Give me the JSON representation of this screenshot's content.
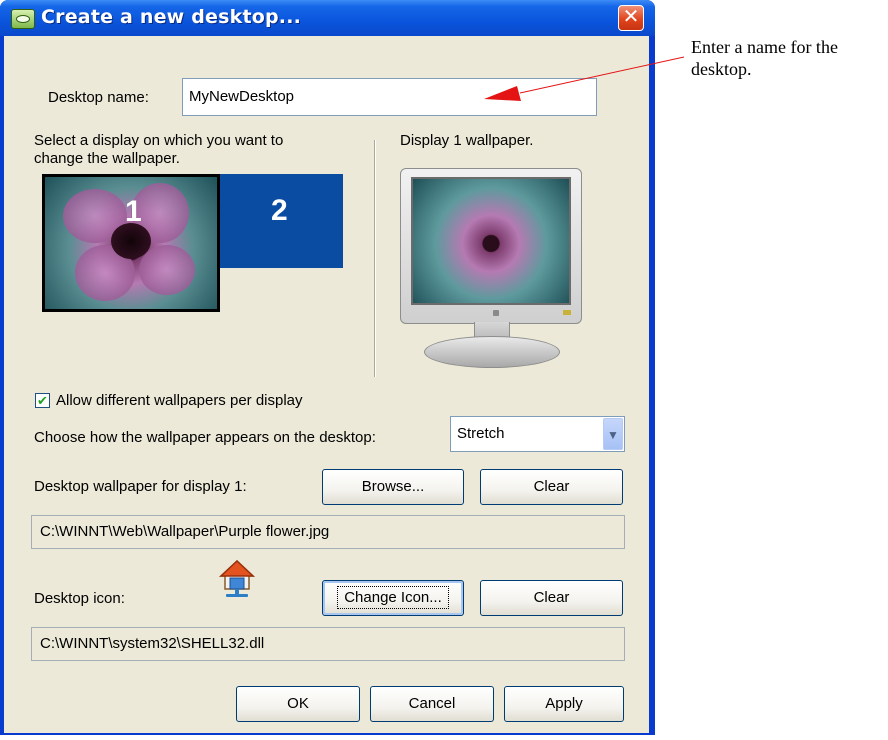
{
  "window": {
    "title": "Create a new desktop..."
  },
  "desktop_name": {
    "label": "Desktop name:",
    "value": "MyNewDesktop"
  },
  "display_selector": {
    "instruction_line1": "Select a display on which you want to",
    "instruction_line2": "change the wallpaper.",
    "display1_label": "1",
    "display2_label": "2"
  },
  "preview": {
    "caption": "Display 1 wallpaper."
  },
  "options": {
    "allow_different_wallpapers_label": "Allow different wallpapers per display",
    "allow_different_wallpapers_checked": true,
    "appearance_label": "Choose how the wallpaper appears on the desktop:",
    "appearance_value": "Stretch"
  },
  "wallpaper": {
    "label": "Desktop wallpaper for display 1:",
    "browse_label": "Browse...",
    "clear_label": "Clear",
    "path": "C:\\WINNT\\Web\\Wallpaper\\Purple flower.jpg"
  },
  "icon": {
    "label": "Desktop icon:",
    "change_label": "Change Icon...",
    "clear_label": "Clear",
    "path": "C:\\WINNT\\system32\\SHELL32.dll"
  },
  "footer": {
    "ok_label": "OK",
    "cancel_label": "Cancel",
    "apply_label": "Apply"
  },
  "annotation": {
    "text": "Enter a name for the desktop."
  },
  "colors": {
    "titlebar": "#0a55dc",
    "dialog_bg": "#ece9d8",
    "display2_bg": "#0b4ca3",
    "annotation_arrow": "#e41414"
  }
}
